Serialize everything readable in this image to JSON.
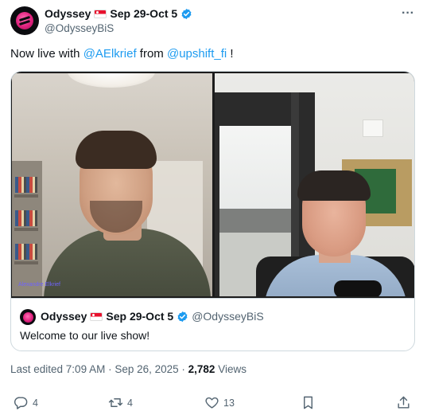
{
  "author": {
    "name": "Odyssey",
    "dates": "Sep 29-Oct 5",
    "handle": "@OdysseyBiS"
  },
  "post": {
    "text_prefix": "Now live with ",
    "mention_1": "@AElkrief",
    "text_middle": " from ",
    "mention_2": "@upshift_fi",
    "text_suffix": " !"
  },
  "media": {
    "participant_label": "Alexandre Elkrief"
  },
  "quoted": {
    "name": "Odyssey",
    "dates": "Sep 29-Oct 5",
    "handle": "@OdysseyBiS",
    "text": "Welcome to our live show!"
  },
  "meta": {
    "edited": "Last edited 7:09 AM · Sep 26, 2025 · ",
    "views_count": "2,782",
    "views_label": " Views"
  },
  "actions": {
    "replies": "4",
    "reposts": "4",
    "likes": "13"
  },
  "colors": {
    "link": "#1d9bf0",
    "secondary_text": "#536471",
    "brand_pink": "#e0207d",
    "verified": "#1d9bf0"
  },
  "icons": [
    "more-icon",
    "verified-icon",
    "reply-icon",
    "repost-icon",
    "like-icon",
    "bookmark-icon",
    "share-icon"
  ]
}
